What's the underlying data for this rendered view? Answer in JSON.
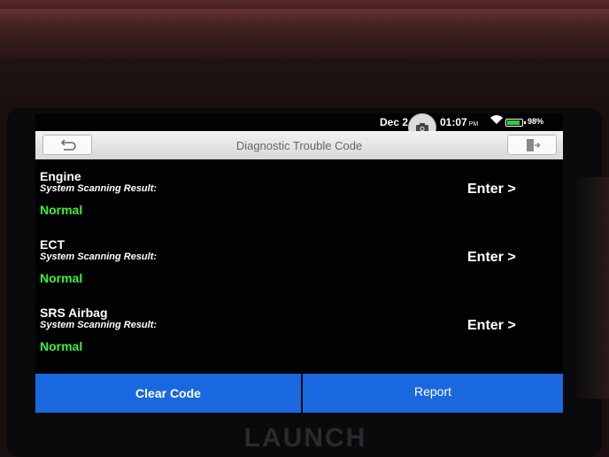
{
  "status_bar": {
    "date": "Dec 2",
    "time": "01:07",
    "ampm": "PM",
    "battery": "98%",
    "battery_level": 0.98
  },
  "header": {
    "title": "Diagnostic Trouble Code",
    "back_icon": "back-arrow-icon",
    "exit_icon": "exit-door-icon"
  },
  "systems": [
    {
      "name": "Engine",
      "subtitle": "System Scanning Result:",
      "status": "Normal",
      "enter_label": "Enter >"
    },
    {
      "name": "ECT",
      "subtitle": "System Scanning Result:",
      "status": "Normal",
      "enter_label": "Enter >"
    },
    {
      "name": "SRS Airbag",
      "subtitle": "System Scanning Result:",
      "status": "Normal",
      "enter_label": "Enter >"
    }
  ],
  "footer": {
    "clear_label": "Clear Code",
    "report_label": "Report"
  },
  "device": {
    "brand": "LAUNCH"
  },
  "colors": {
    "accent": "#1a68e0",
    "status_ok": "#3ef03a",
    "screen_bg": "#020204"
  }
}
